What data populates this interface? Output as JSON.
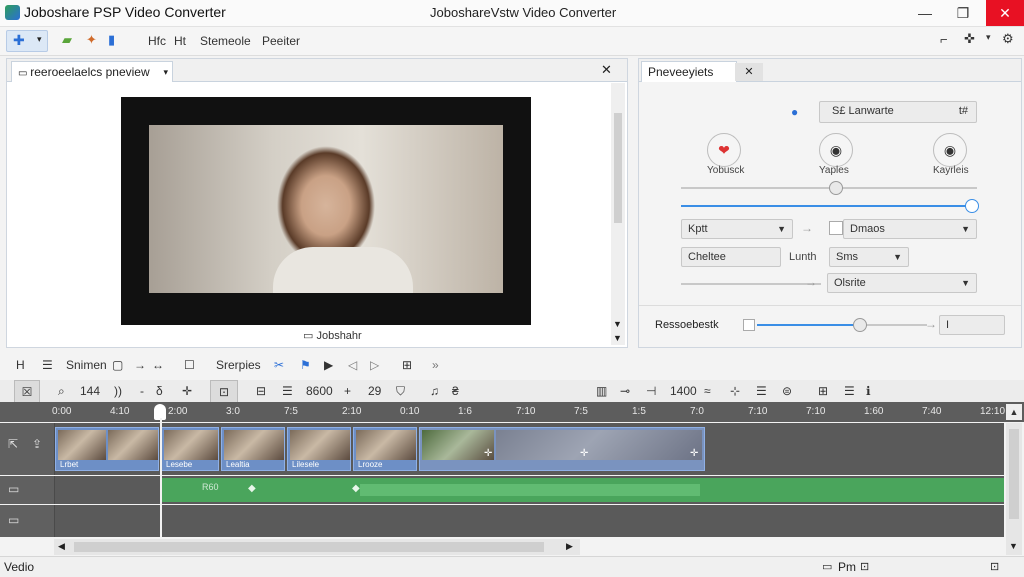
{
  "window": {
    "app_title": "Joboshare PSP Video Converter",
    "center_title": "JoboshareVstw Video Converter"
  },
  "menu": {
    "items": [
      "Hfc",
      "Ht",
      "Stemeole",
      "Peeiter"
    ]
  },
  "preview": {
    "tab_label": "reeroeelaelcs pneview",
    "caption": "Jobshahr"
  },
  "right_panel": {
    "tab_label": "Pneveeyiets",
    "dropdown_top": "S£ Lanwarte",
    "dropdown_top_value": "t#",
    "circle_labels": [
      "Yobusck",
      "Yaples",
      "Kayrleis"
    ],
    "row1_left": "Kptt",
    "row1_right": "Dmaos",
    "row2_left": "Cheltee",
    "row2_mid": "Lunth",
    "row2_mid_value": "Sms",
    "row3_right": "Olsrite",
    "slider_label": "Ressoebestk",
    "slider_value": "I"
  },
  "toolbar1": {
    "label1": "Snimen",
    "label2": "Srerpies"
  },
  "toolbar2": {
    "values": [
      "144",
      "))",
      "8600",
      "29",
      "1400"
    ]
  },
  "ruler": {
    "ticks": [
      "0:00",
      "4:10",
      "2:00",
      "3:0",
      "7:5",
      "2:10",
      "0:10",
      "1:6",
      "7:10",
      "7:5",
      "1:5",
      "7:0",
      "7:10",
      "7:10",
      "1:60",
      "7:40",
      "12:10"
    ]
  },
  "timeline": {
    "clip_labels": [
      "Lrbet",
      "Lesebe",
      "Lealtia",
      "Lilesele",
      "Lrooze"
    ],
    "audio_label": "R60"
  },
  "status": {
    "left": "Vedio",
    "right": "Pm"
  },
  "colors": {
    "accent": "#3a8ee6",
    "close": "#e81123",
    "clip": "#6d8fc6",
    "audio": "#4aa55c"
  }
}
